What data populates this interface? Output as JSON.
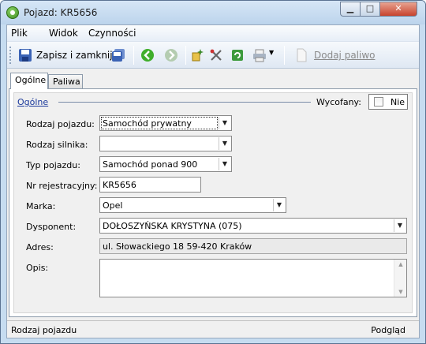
{
  "window": {
    "title": "Pojazd: KR5656",
    "min_glyph": "▁",
    "max_glyph": "□",
    "close_glyph": "✕"
  },
  "menu": {
    "items": [
      "Plik",
      "Widok",
      "Czynności"
    ]
  },
  "toolbar": {
    "save_close_label": "Zapisz i zamknij",
    "add_fuel_label": "Dodaj paliwo"
  },
  "tabs": [
    "Ogólne",
    "Paliwa"
  ],
  "section": {
    "title": "Ogólne",
    "withdrawn_label": "Wycofany:",
    "withdrawn_value": "Nie",
    "withdrawn_checked": false
  },
  "form": {
    "vehicle_kind": {
      "label": "Rodzaj pojazdu:",
      "value": "Samochód prywatny"
    },
    "engine_kind": {
      "label": "Rodzaj silnika:",
      "value": ""
    },
    "vehicle_type": {
      "label": "Typ pojazdu:",
      "value": "Samochód ponad 900"
    },
    "reg_no": {
      "label": "Nr rejestracyjny:",
      "value": "KR5656"
    },
    "make": {
      "label": "Marka:",
      "value": "Opel"
    },
    "dispatcher": {
      "label": "Dysponent:",
      "value": "DOŁOSZYŃSKA KRYSTYNA (075)"
    },
    "address": {
      "label": "Adres:",
      "value": "ul. Słowackiego 18 59-420 Kraków"
    },
    "notes": {
      "label": "Opis:",
      "value": ""
    }
  },
  "status": {
    "left": "Rodzaj pojazdu",
    "right": "Podgląd"
  },
  "icons": [
    "app-icon",
    "save-icon",
    "save-copy-icon",
    "back-icon",
    "forward-icon",
    "new-item-icon",
    "tools-icon",
    "refresh-icon",
    "print-icon",
    "add-fuel-icon"
  ]
}
